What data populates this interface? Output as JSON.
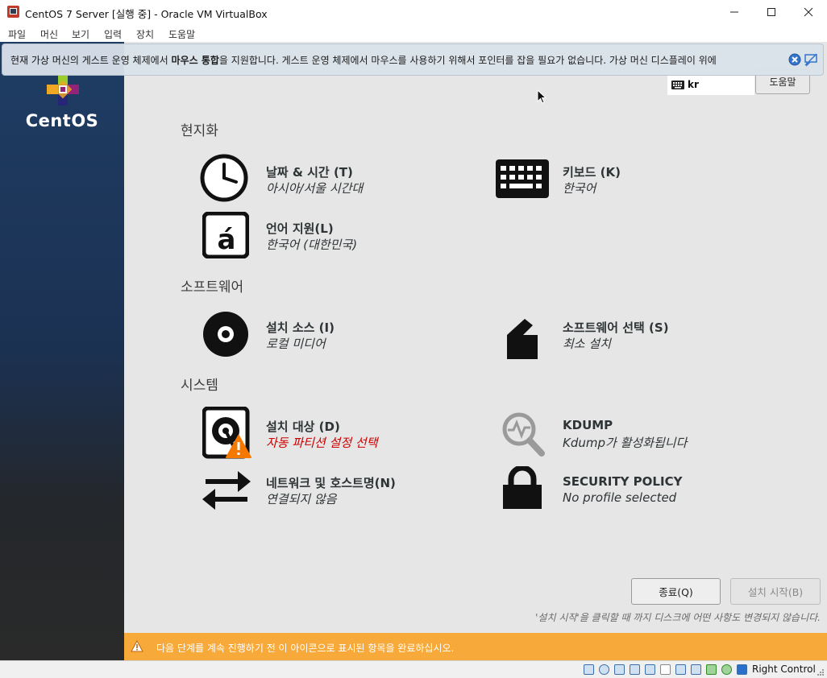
{
  "window": {
    "title": "CentOS 7 Server [실행 중] - Oracle VM VirtualBox",
    "minimize_icon": "minimize-icon",
    "maximize_icon": "maximize-icon",
    "close_icon": "close-icon"
  },
  "menubar": {
    "items": [
      "파일",
      "머신",
      "보기",
      "입력",
      "장치",
      "도움말"
    ]
  },
  "notification": {
    "text_before": "현재 가상 머신의 게스트 운영 체제에서 ",
    "text_bold": "마우스 통합",
    "text_after": "을 지원합니다. 게스트 운영 체제에서 마우스를 사용하기 위해서 포인터를 잡을 필요가 없습니다. 가상 머신 디스플레이 위에"
  },
  "sidebar": {
    "logo_text": "CentOS"
  },
  "top": {
    "keyboard_layout": "kr",
    "help_label": "도움말"
  },
  "sections": {
    "localization": "현지화",
    "software": "소프트웨어",
    "system": "시스템"
  },
  "spokes": {
    "datetime": {
      "title": "날짜 & 시간 (T)",
      "status": "아시아/서울 시간대",
      "icon": "clock-icon"
    },
    "keyboard": {
      "title": "키보드 (K)",
      "status": "한국어",
      "icon": "keyboard-icon"
    },
    "language": {
      "title": "언어 지원(L)",
      "status": "한국어 (대한민국)",
      "icon": "language-icon"
    },
    "source": {
      "title": "설치 소스 (I)",
      "status": "로컬 미디어",
      "icon": "disc-icon"
    },
    "software_selection": {
      "title": "소프트웨어 선택 (S)",
      "status": "최소 설치",
      "icon": "package-icon"
    },
    "destination": {
      "title": "설치 대상 (D)",
      "status": "자동 파티션 설정 선택",
      "icon": "harddisk-warning-icon"
    },
    "kdump": {
      "title": "KDUMP",
      "status": "Kdump가 활성화됩니다",
      "icon": "magnifier-icon"
    },
    "network": {
      "title": "네트워크 및 호스트명(N)",
      "status": "연결되지 않음",
      "icon": "network-arrows-icon"
    },
    "security": {
      "title": "SECURITY POLICY",
      "status": "No profile selected",
      "icon": "lock-icon"
    }
  },
  "buttons": {
    "quit": "종료(Q)",
    "begin": "설치 시작(B)"
  },
  "note": "'설치 시작'을 클릭할 때 까지 디스크에 어떤 사항도 변경되지 않습니다.",
  "warning_bar": {
    "text": "다음 단계를 계속 진행하기 전 이 아이콘으로 표시된 항목을 완료하십시오.",
    "color": "#f7a93a"
  },
  "statusbar": {
    "host_key": "Right Control"
  },
  "colors": {
    "accent_warning": "#cc0000",
    "sidebar_top": "#1f3d64"
  }
}
